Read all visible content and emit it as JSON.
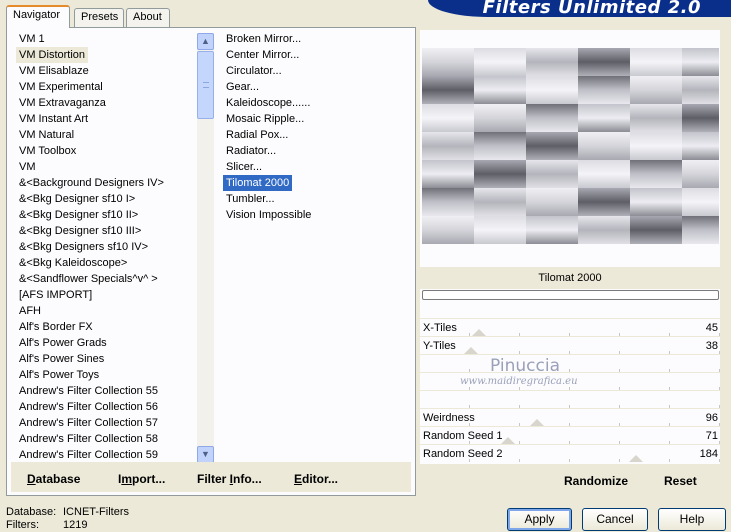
{
  "header": {
    "title": "Filters Unlimited 2.0"
  },
  "tabs": [
    {
      "label": "Navigator",
      "active": true
    },
    {
      "label": "Presets",
      "active": false
    },
    {
      "label": "About",
      "active": false
    }
  ],
  "categories": [
    "VM 1",
    "VM Distortion",
    "VM Elisablaze",
    "VM Experimental",
    "VM Extravaganza",
    "VM Instant Art",
    "VM Natural",
    "VM Toolbox",
    "VM",
    "&<Background Designers IV>",
    "&<Bkg Designer sf10 I>",
    "&<Bkg Designer sf10 II>",
    "&<Bkg Designer sf10 III>",
    "&<Bkg Designers sf10 IV>",
    "&<Bkg Kaleidoscope>",
    "&<Sandflower Specials^v^ >",
    "[AFS IMPORT]",
    "AFH",
    "Alf's Border FX",
    "Alf's Power Grads",
    "Alf's Power Sines",
    "Alf's Power Toys",
    "Andrew's Filter Collection 55",
    "Andrew's Filter Collection 56",
    "Andrew's Filter Collection 57",
    "Andrew's Filter Collection 58",
    "Andrew's Filter Collection 59"
  ],
  "selected_category": "VM Distortion",
  "filters": [
    "Broken Mirror...",
    "Center Mirror...",
    "Circulator...",
    "Gear...",
    "Kaleidoscope......",
    "Mosaic Ripple...",
    "Radial Pox...",
    "Radiator...",
    "Slicer...",
    "Tilomat 2000",
    "Tumbler...",
    "Vision Impossible"
  ],
  "selected_filter": "Tilomat 2000",
  "left_buttons": {
    "database": {
      "u": "D",
      "rest": "atabase"
    },
    "import": {
      "pre": "I",
      "u": "m",
      "rest": "port..."
    },
    "filter_info": {
      "pre": "Filter ",
      "u": "I",
      "rest": "nfo..."
    },
    "editor": {
      "u": "E",
      "rest": "ditor..."
    }
  },
  "preview": {
    "filter_name": "Tilomat 2000"
  },
  "sliders": [
    {
      "label": "X-Tiles",
      "value": "45",
      "level": 0.18
    },
    {
      "label": "Y-Tiles",
      "value": "38",
      "level": 0.15
    },
    {
      "label": "",
      "value": "",
      "level": null
    },
    {
      "label": "",
      "value": "",
      "level": null
    },
    {
      "label": "",
      "value": "",
      "level": null
    },
    {
      "label": "Weirdness",
      "value": "96",
      "level": 0.38
    },
    {
      "label": "Random Seed 1",
      "value": "71",
      "level": 0.28
    },
    {
      "label": "Random Seed 2",
      "value": "184",
      "level": 0.72
    }
  ],
  "watermark": {
    "title": "Pinuccia",
    "subtitle": "www.maidiregrafica.eu"
  },
  "right_buttons": {
    "randomize": "Randomize",
    "reset": "Reset"
  },
  "status": {
    "database_label": "Database:",
    "database_value": "ICNET-Filters",
    "filters_label": "Filters:",
    "filters_value": "1219"
  },
  "buttons": {
    "apply": "Apply",
    "cancel": "Cancel",
    "help": "Help"
  },
  "scroll_icons": {
    "up": "chevron-up-icon",
    "down": "chevron-down-icon"
  },
  "colors": {
    "selection": "#316ac5",
    "banner": "#0a2f8a",
    "dialog": "#ece9d8"
  }
}
